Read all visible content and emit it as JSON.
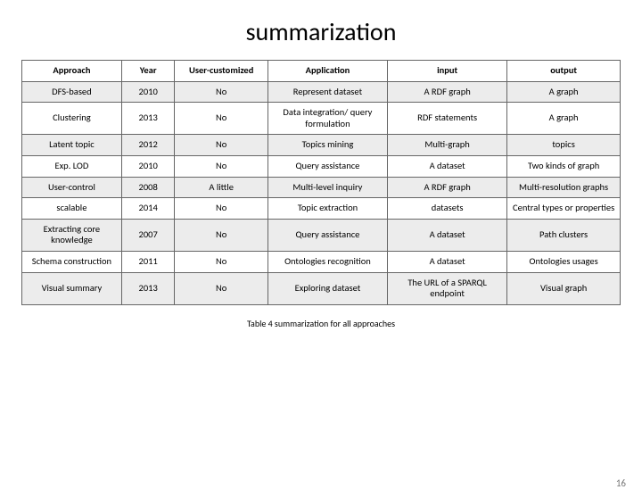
{
  "title": "summarization",
  "headers": [
    "Approach",
    "Year",
    "User-customized",
    "Application",
    "input",
    "output"
  ],
  "rows": [
    [
      "DFS-based",
      "2010",
      "No",
      "Represent dataset",
      "A RDF graph",
      "A graph"
    ],
    [
      "Clustering",
      "2013",
      "No",
      "Data integration/ query formulation",
      "RDF statements",
      "A graph"
    ],
    [
      "Latent topic",
      "2012",
      "No",
      "Topics mining",
      "Multi-graph",
      "topics"
    ],
    [
      "Exp. LOD",
      "2010",
      "No",
      "Query assistance",
      "A dataset",
      "Two kinds of graph"
    ],
    [
      "User-control",
      "2008",
      "A little",
      "Multi-level inquiry",
      "A RDF graph",
      "Multi-resolution graphs"
    ],
    [
      "scalable",
      "2014",
      "No",
      "Topic extraction",
      "datasets",
      "Central types or properties"
    ],
    [
      "Extracting core knowledge",
      "2007",
      "No",
      "Query assistance",
      "A dataset",
      "Path clusters"
    ],
    [
      "Schema construction",
      "2011",
      "No",
      "Ontologies recognition",
      "A dataset",
      "Ontologies usages"
    ],
    [
      "Visual summary",
      "2013",
      "No",
      "Exploring dataset",
      "The URL of a SPARQL endpoint",
      "Visual graph"
    ]
  ],
  "caption": "Table 4  summarization for all approaches",
  "page_number": "16",
  "chart_data": {
    "type": "table",
    "title": "summarization",
    "columns": [
      "Approach",
      "Year",
      "User-customized",
      "Application",
      "input",
      "output"
    ],
    "rows": [
      {
        "Approach": "DFS-based",
        "Year": 2010,
        "User-customized": "No",
        "Application": "Represent dataset",
        "input": "A RDF graph",
        "output": "A graph"
      },
      {
        "Approach": "Clustering",
        "Year": 2013,
        "User-customized": "No",
        "Application": "Data integration/ query formulation",
        "input": "RDF statements",
        "output": "A graph"
      },
      {
        "Approach": "Latent topic",
        "Year": 2012,
        "User-customized": "No",
        "Application": "Topics mining",
        "input": "Multi-graph",
        "output": "topics"
      },
      {
        "Approach": "Exp. LOD",
        "Year": 2010,
        "User-customized": "No",
        "Application": "Query assistance",
        "input": "A dataset",
        "output": "Two kinds of graph"
      },
      {
        "Approach": "User-control",
        "Year": 2008,
        "User-customized": "A little",
        "Application": "Multi-level inquiry",
        "input": "A RDF graph",
        "output": "Multi-resolution graphs"
      },
      {
        "Approach": "scalable",
        "Year": 2014,
        "User-customized": "No",
        "Application": "Topic extraction",
        "input": "datasets",
        "output": "Central types or properties"
      },
      {
        "Approach": "Extracting core knowledge",
        "Year": 2007,
        "User-customized": "No",
        "Application": "Query assistance",
        "input": "A dataset",
        "output": "Path clusters"
      },
      {
        "Approach": "Schema construction",
        "Year": 2011,
        "User-customized": "No",
        "Application": "Ontologies recognition",
        "input": "A dataset",
        "output": "Ontologies usages"
      },
      {
        "Approach": "Visual summary",
        "Year": 2013,
        "User-customized": "No",
        "Application": "Exploring dataset",
        "input": "The URL of a SPARQL endpoint",
        "output": "Visual graph"
      }
    ]
  }
}
